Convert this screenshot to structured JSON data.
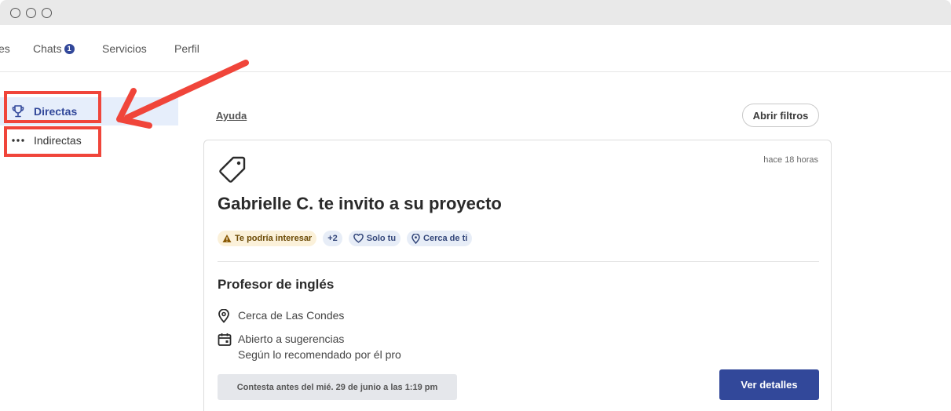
{
  "window": {
    "controls": [
      "window-dot-1",
      "window-dot-2",
      "window-dot-3"
    ]
  },
  "topnav": {
    "items": [
      {
        "label": "es"
      },
      {
        "label": "Chats",
        "badge": "1"
      },
      {
        "label": "Servicios"
      },
      {
        "label": "Perfil"
      }
    ]
  },
  "sidebar": {
    "items": [
      {
        "label": "Directas",
        "icon": "trophy-icon",
        "active": true
      },
      {
        "label": "Indirectas",
        "icon": "more-dots-icon",
        "active": false
      }
    ]
  },
  "main": {
    "help_link": "Ayuda",
    "filters_button": "Abrir filtros",
    "card": {
      "timestamp": "hace 18 horas",
      "icon": "tag-icon",
      "title": "Gabrielle C. te invito a su proyecto",
      "chips": [
        {
          "label": "Te podría interesar",
          "icon": "warning-icon"
        },
        {
          "label": "+2"
        },
        {
          "label": "Solo tu",
          "icon": "heart-icon"
        },
        {
          "label": "Cerca de ti",
          "icon": "location-pin-icon"
        }
      ],
      "subtitle": "Profesor de inglés",
      "location": "Cerca de Las Condes",
      "schedule_line1": "Abierto a sugerencias",
      "schedule_line2": "Según lo recomendado por él pro",
      "deadline": "Contesta antes del mié. 29 de junio a las 1:19 pm",
      "details_button": "Ver detalles"
    }
  },
  "colors": {
    "brand": "#32489a",
    "active_bg": "#e6eefb",
    "annotation": "#f0453a"
  }
}
